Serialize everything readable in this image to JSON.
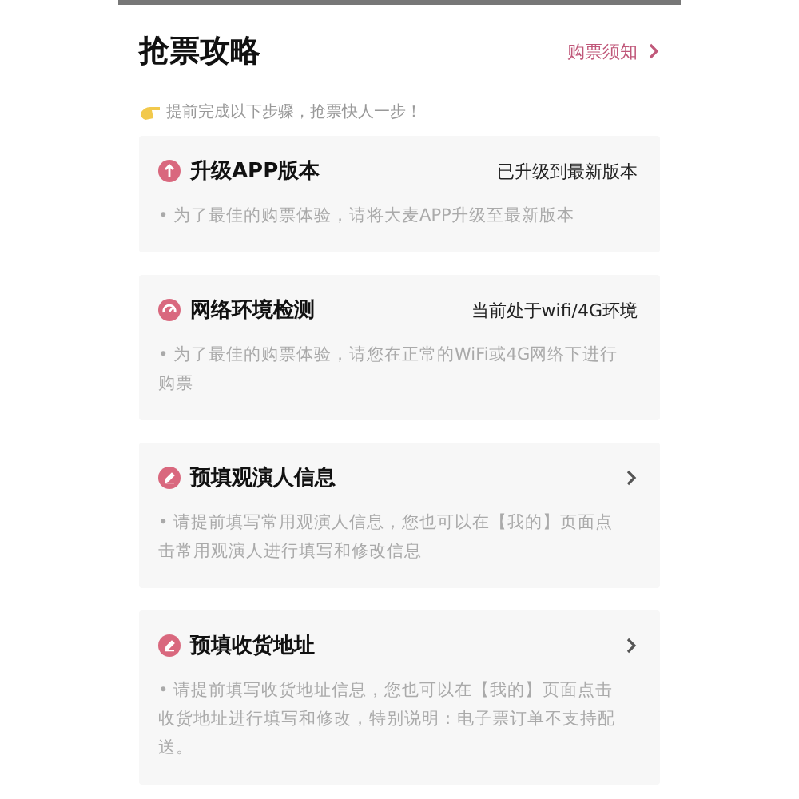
{
  "header": {
    "title": "抢票攻略",
    "link": "购票须知"
  },
  "tip": "提前完成以下步骤，抢票快人一步！",
  "steps": [
    {
      "kind": "status",
      "title": "升级APP版本",
      "status": "已升级到最新版本",
      "description": "• 为了最佳的购票体验，请将大麦APP升级至最新版本"
    },
    {
      "kind": "status",
      "title": "网络环境检测",
      "status": "当前处于wifi/4G环境",
      "description": "• 为了最佳的购票体验，请您在正常的WiFi或4G网络下进行购票"
    },
    {
      "kind": "link",
      "title": "预填观演人信息",
      "description": "• 请提前填写常用观演人信息，您也可以在【我的】页面点击常用观演人进行填写和修改信息"
    },
    {
      "kind": "link",
      "title": "预填收货地址",
      "description": "• 请提前填写收货地址信息，您也可以在【我的】页面点击收货地址进行填写和修改，特别说明：电子票订单不支持配送。"
    }
  ]
}
